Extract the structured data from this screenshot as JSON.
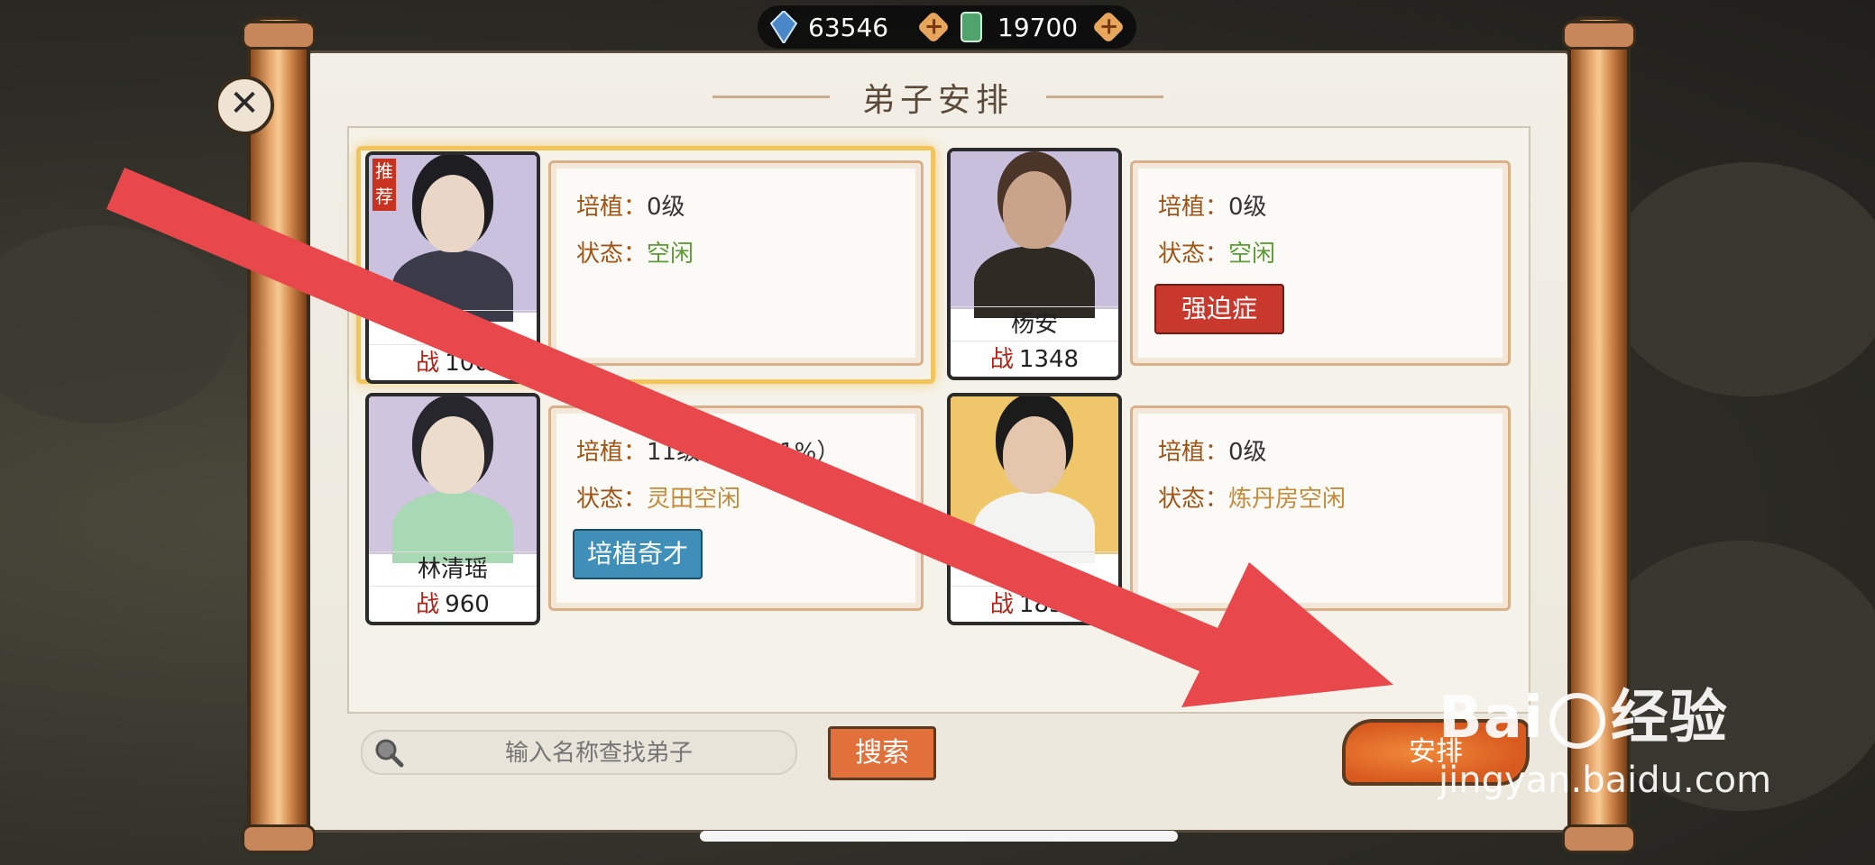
{
  "currency": {
    "gems": {
      "icon": "blue-crystal-icon",
      "value": "63546"
    },
    "jade": {
      "icon": "green-jade-icon",
      "value": "19700"
    }
  },
  "panel": {
    "title": "弟子安排"
  },
  "disciples": [
    {
      "name": "",
      "power_label": "战",
      "power": "100",
      "cultivate_label": "培植：",
      "cultivate": "0级",
      "status_label": "状态：",
      "status": "空闲",
      "status_color": "#5c9b35",
      "badge": "推荐",
      "selected": true,
      "portrait_bg": "#c9c1de"
    },
    {
      "name": "杨安",
      "power_label": "战",
      "power": "1348",
      "cultivate_label": "培植：",
      "cultivate": "0级",
      "status_label": "状态：",
      "status": "空闲",
      "status_color": "#5c9b35",
      "trait": "强迫症",
      "trait_color": "#c8382c",
      "portrait_bg": "#c7bfdc"
    },
    {
      "name": "林清瑶",
      "power_label": "战",
      "power": "960",
      "cultivate_label": "培植：",
      "cultivate": "11级（",
      "cultivate_tail": "1%）",
      "status_label": "状态：",
      "status": "灵田空闲",
      "status_color": "#c38b3b",
      "trait": "培植奇才",
      "trait_color": "#3f8fb8",
      "portrait_bg": "#cfc5df"
    },
    {
      "name": "韩",
      "power_label": "战",
      "power": "1833",
      "cultivate_label": "培植：",
      "cultivate": "0级",
      "status_label": "状态：",
      "status": "炼丹房空闲",
      "status_color": "#c38b3b",
      "portrait_bg": "#f0c66a"
    }
  ],
  "search": {
    "placeholder": "输入名称查找弟子",
    "button": "搜索"
  },
  "arrange_button": "安排",
  "watermark": {
    "brand": "Bai",
    "brand2": "经验",
    "url": "jingyan.baidu.com"
  },
  "colors": {
    "accent_orange": "#e2703b",
    "arrow_red": "#e8484c"
  }
}
